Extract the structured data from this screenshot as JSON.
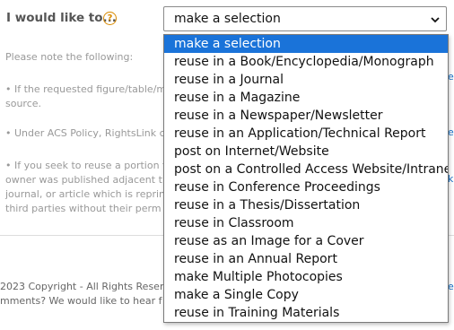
{
  "form": {
    "label": "I would like to...",
    "help_glyph": "?",
    "selected_value": "make a selection"
  },
  "notes": {
    "intro": "Please note the following:",
    "bullet1": [
      "• If the requested figure/table/m",
      "source."
    ],
    "bullet2": "• Under ACS Policy, RightsLink c",
    "bullet3": [
      "• If you seek to reuse a portion t",
      "owner was published adjacent t",
      "journal, or article which is reprin",
      "third parties without their perm"
    ]
  },
  "footer": {
    "copyright": "2023 Copyright - All Rights Reserv",
    "comments": "mments? We would like to hear f"
  },
  "edge_fragments": [
    "e",
    "e",
    "k",
    "e"
  ],
  "dropdown": {
    "options": [
      "make a selection",
      "reuse in a Book/Encyclopedia/Monograph",
      "reuse in a Journal",
      "reuse in a Magazine",
      "reuse in a Newspaper/Newsletter",
      "reuse in an Application/Technical Report",
      "post on Internet/Website",
      "post on a Controlled Access Website/Intranet",
      "reuse in Conference Proceedings",
      "reuse in a Thesis/Dissertation",
      "reuse in Classroom",
      "reuse as an Image for a Cover",
      "reuse in an Annual Report",
      "make Multiple Photocopies",
      "make a Single Copy",
      "reuse in Training Materials"
    ],
    "highlighted_index": 0
  },
  "colors": {
    "highlight": "#1a73d9",
    "help_icon": "#d98a00"
  }
}
